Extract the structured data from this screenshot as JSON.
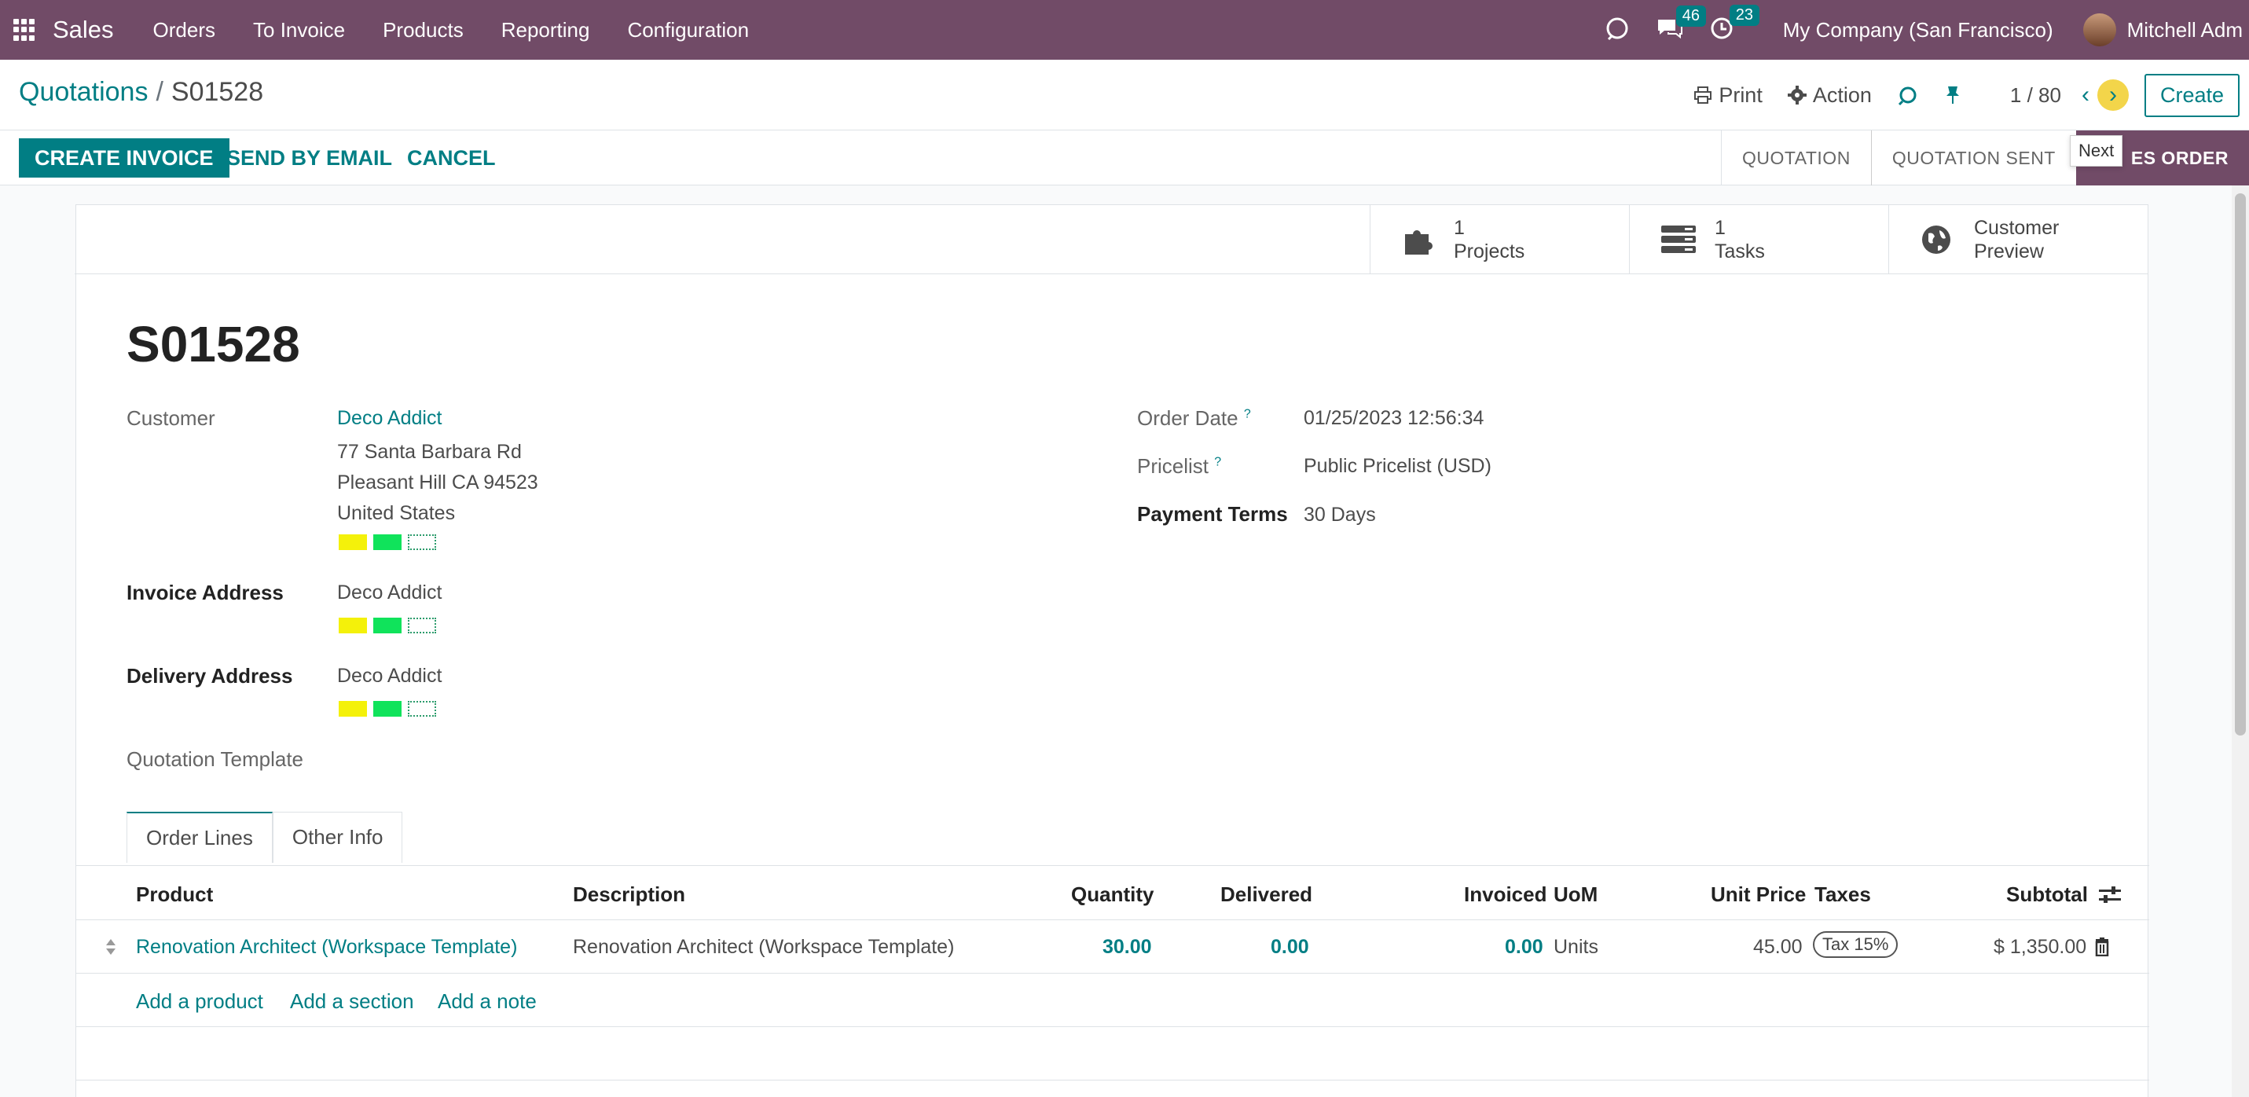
{
  "topbar": {
    "app_name": "Sales",
    "menu": [
      "Orders",
      "To Invoice",
      "Products",
      "Reporting",
      "Configuration"
    ],
    "messages_count": "46",
    "activities_count": "23",
    "company": "My Company (San Francisco)",
    "user": "Mitchell Adm"
  },
  "breadcrumb": {
    "parent": "Quotations",
    "separator": "/",
    "current": "S01528"
  },
  "control": {
    "print": "Print",
    "action": "Action",
    "pager": "1 / 80",
    "create": "Create",
    "tooltip": "Next"
  },
  "statusbar": {
    "create_invoice": "CREATE INVOICE",
    "send_email": "SEND BY EMAIL",
    "cancel": "CANCEL",
    "stages": [
      "QUOTATION",
      "QUOTATION SENT",
      "ES ORDER"
    ]
  },
  "smart_buttons": [
    {
      "count": "1",
      "label": "Projects"
    },
    {
      "count": "1",
      "label": "Tasks"
    },
    {
      "count": "Customer",
      "label": "Preview"
    }
  ],
  "form": {
    "title": "S01528",
    "customer_label": "Customer",
    "customer_name": "Deco Addict",
    "address1": "77 Santa Barbara Rd",
    "address2": "Pleasant Hill CA 94523",
    "address3": "United States",
    "invoice_label": "Invoice Address",
    "invoice_value": "Deco Addict",
    "delivery_label": "Delivery Address",
    "delivery_value": "Deco Addict",
    "template_label": "Quotation Template",
    "order_date_label": "Order Date",
    "order_date_value": "01/25/2023 12:56:34",
    "pricelist_label": "Pricelist",
    "pricelist_value": "Public Pricelist (USD)",
    "payment_terms_label": "Payment Terms",
    "payment_terms_value": "30 Days",
    "help_mark": "?"
  },
  "tabs": [
    "Order Lines",
    "Other Info"
  ],
  "table": {
    "headers": {
      "product": "Product",
      "description": "Description",
      "quantity": "Quantity",
      "delivered": "Delivered",
      "invoiced": "Invoiced",
      "uom": "UoM",
      "unit_price": "Unit Price",
      "taxes": "Taxes",
      "subtotal": "Subtotal"
    },
    "row": {
      "product": "Renovation Architect (Workspace Template)",
      "description": "Renovation Architect (Workspace Template)",
      "quantity": "30.00",
      "delivered": "0.00",
      "invoiced": "0.00",
      "uom": "Units",
      "unit_price": "45.00",
      "taxes": "Tax 15%",
      "subtotal": "$ 1,350.00"
    },
    "add_product": "Add a product",
    "add_section": "Add a section",
    "add_note": "Add a note"
  }
}
